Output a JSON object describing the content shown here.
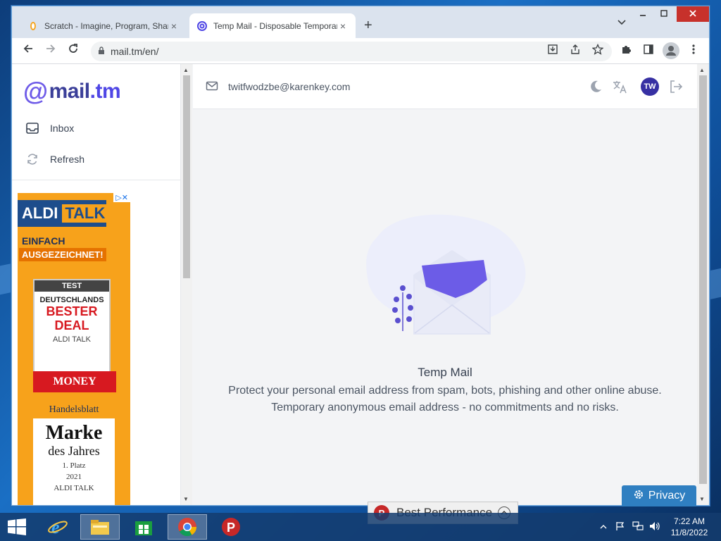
{
  "browser": {
    "tabs": [
      {
        "title": "Scratch - Imagine, Program, Share",
        "active": false
      },
      {
        "title": "Temp Mail - Disposable Temporary Email",
        "active": true
      }
    ],
    "new_tab": "+",
    "url": "mail.tm/en/",
    "close_glyph": "×"
  },
  "sidebar": {
    "logo_at": "@",
    "logo_mail": "mail",
    "logo_tm": ".tm",
    "nav": [
      {
        "label": "Inbox",
        "icon": "inbox-icon"
      },
      {
        "label": "Refresh",
        "icon": "refresh-icon"
      }
    ]
  },
  "ad": {
    "brand_left": "ALDI",
    "brand_right": "TALK",
    "line1": "EINFACH",
    "line2": "AUSGEZEICHNET!",
    "test_header": "TEST",
    "test_line1": "DEUTSCHLANDS",
    "test_line2": "BESTER",
    "test_line3": "DEAL",
    "test_brand": "ALDI TALK",
    "money": "MONEY",
    "hb_header": "Handelsblatt",
    "hb_title1": "Marke",
    "hb_title2": "des Jahres",
    "hb_place": "1. Platz",
    "hb_year": "2021",
    "hb_brand": "ALDI TALK"
  },
  "topbar": {
    "email": "twitfwodzbe@karenkey.com",
    "avatar": "TW"
  },
  "hero": {
    "title": "Temp Mail",
    "description": "Protect your personal email address from spam, bots, phishing and other online abuse. Temporary anonymous email address - no commitments and no risks."
  },
  "privacy": {
    "label": "Privacy"
  },
  "toast": {
    "label": "Best Performance",
    "icon_letter": "P"
  },
  "taskbar": {
    "time": "7:22 AM",
    "date": "11/8/2022"
  },
  "colors": {
    "accent": "#4f46e5",
    "privacy": "#2f7fc1",
    "avatar": "#3730a3"
  }
}
